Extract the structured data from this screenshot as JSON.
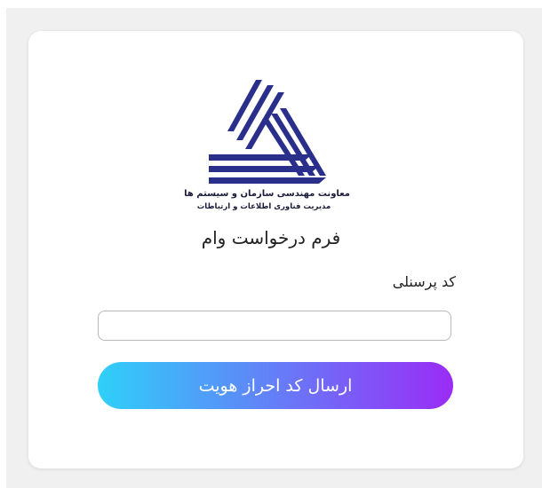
{
  "logo": {
    "icon": "organization-logo-icon",
    "org_line1": "معاونت مهندسی سازمان و سیستم ها",
    "org_line2": "مدیریت فناوری اطلاعات و ارتباطات"
  },
  "form": {
    "title": "فرم درخواست وام",
    "personnel_code_label": "کد پرسنلی",
    "personnel_code_value": "",
    "submit_label": "ارسال کد احراز هویت"
  },
  "colors": {
    "logo_blue": "#2b2f8c",
    "button_gradient_start": "#2fd0f8",
    "button_gradient_end": "#9a2cf6"
  }
}
